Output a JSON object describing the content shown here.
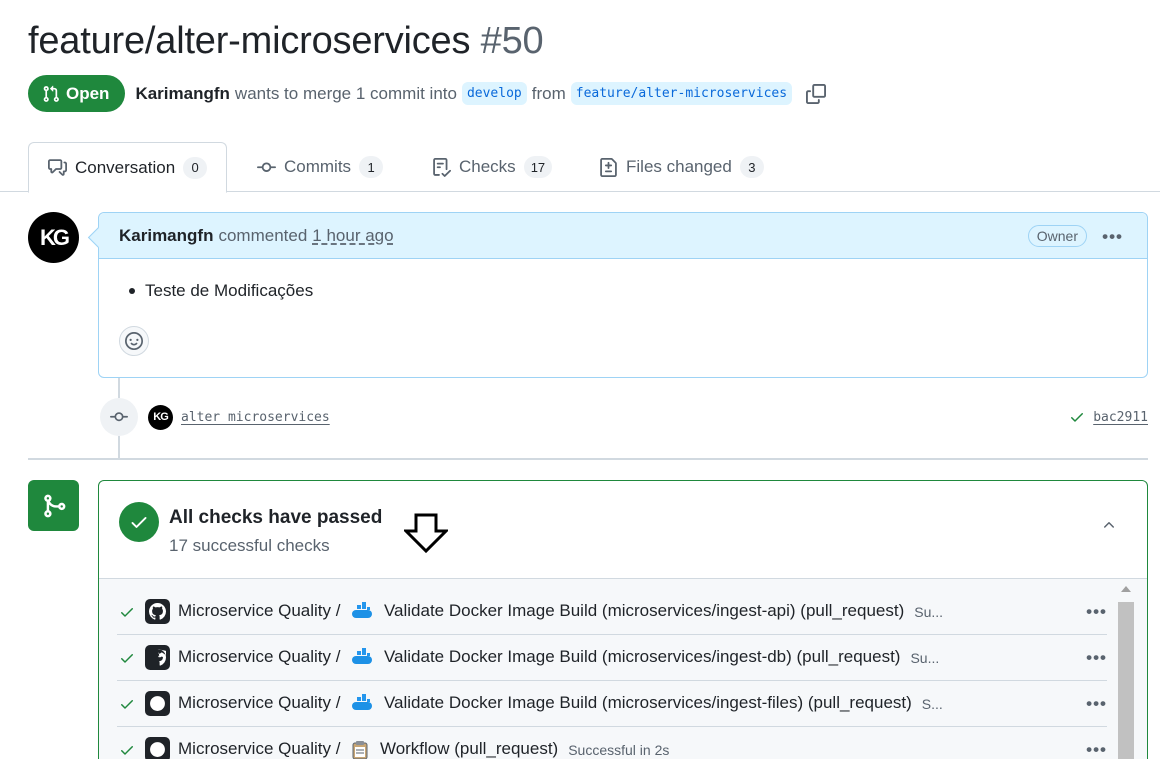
{
  "pr": {
    "title": "feature/alter-microservices",
    "number": "#50",
    "state": "Open",
    "author": "Karimangfn",
    "merge_text": "wants to merge 1 commit into",
    "base_branch": "develop",
    "from_text": "from",
    "head_branch": "feature/alter-microservices"
  },
  "tabs": [
    {
      "label": "Conversation",
      "count": "0"
    },
    {
      "label": "Commits",
      "count": "1"
    },
    {
      "label": "Checks",
      "count": "17"
    },
    {
      "label": "Files changed",
      "count": "3"
    }
  ],
  "comment": {
    "author": "Karimangfn",
    "action": "commented",
    "time": "1 hour ago",
    "badge": "Owner",
    "body_items": [
      "Teste de Modificações"
    ],
    "avatar_text": "KG"
  },
  "commit": {
    "message": "alter microservices",
    "sha": "bac2911"
  },
  "checks": {
    "title": "All checks have passed",
    "subtitle": "17 successful checks",
    "rows": [
      {
        "workflow": "Microservice Quality /",
        "job": "Validate Docker Image Build (microservices/ingest-api) (pull_request)",
        "status": "Su...",
        "app_icon": "docker-icon"
      },
      {
        "workflow": "Microservice Quality /",
        "job": "Validate Docker Image Build (microservices/ingest-db) (pull_request)",
        "status": "Su...",
        "app_icon": "docker-icon"
      },
      {
        "workflow": "Microservice Quality /",
        "job": "Validate Docker Image Build (microservices/ingest-files) (pull_request)",
        "status": "S...",
        "app_icon": "docker-icon"
      },
      {
        "workflow": "Microservice Quality /",
        "job": "Workflow (pull_request)",
        "status": "Successful in 2s",
        "app_icon": "clipboard-icon"
      }
    ]
  },
  "colors": {
    "success": "#1f883d",
    "link": "#0969da",
    "comment_header": "#ddf4ff"
  }
}
